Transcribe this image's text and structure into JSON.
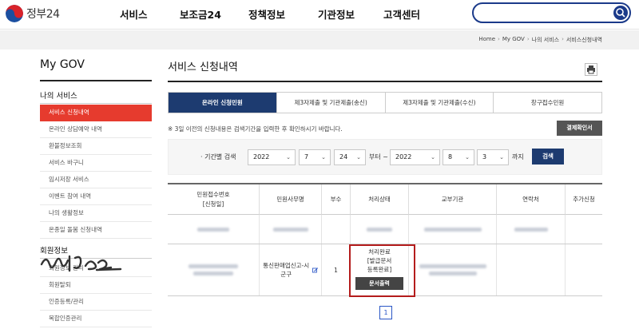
{
  "header": {
    "logo_text": "정부24",
    "nav": [
      "서비스",
      "보조금24",
      "정책정보",
      "기관정보",
      "고객센터"
    ],
    "search_placeholder": ""
  },
  "breadcrumb": [
    "Home",
    "My GOV",
    "나의 서비스",
    "서비스신청내역"
  ],
  "sidebar": {
    "title": "My GOV",
    "section1": "나의 서비스",
    "items": [
      "서비스 신청내역",
      "온라인 상담예약 내역",
      "환불정보조회",
      "서비스 바구니",
      "임시저장 서비스",
      "이벤트 참여 내역",
      "나의 생활정보",
      "온종일 돌봄 신청내역"
    ],
    "section2": "회원정보",
    "items2": [
      "회원정보 관리",
      "회원탈퇴",
      "인증등록/관리",
      "복합인증관리"
    ]
  },
  "main": {
    "title": "서비스 신청내역",
    "tabs": [
      "온라인 신청민원",
      "제3자제출 및 기관제출(송신)",
      "제3자제출 및 기관제출(수신)",
      "창구접수민원"
    ],
    "notice": "※ 3일 이전의 신청내용은 검색기간을 입력한 후 확인하시기 바랍니다.",
    "confirm_button": "결제확인서",
    "filter": {
      "label": "· 기간별 검색",
      "from_year": "2022",
      "from_month": "7",
      "from_day": "24",
      "middle": "부터 ~",
      "to_year": "2022",
      "to_month": "8",
      "to_day": "3",
      "end": "까지",
      "search_button": "검색"
    },
    "table": {
      "headers": [
        "민원접수번호\n[신청일]",
        "민원사무명",
        "부수",
        "처리상태",
        "교부기관",
        "연락처",
        "추가신청"
      ],
      "row2": {
        "service": "통신판매업신고-시군구",
        "copies": "1",
        "status_line1": "처리완료",
        "status_line2": "[발급문서",
        "status_line3": "등록완료]",
        "print_button": "문서출력"
      }
    },
    "pagination": [
      "1"
    ]
  },
  "colors": {
    "brand_navy": "#1d3b70",
    "accent_red": "#e63b2e",
    "highlight_red": "#b41c1c"
  }
}
